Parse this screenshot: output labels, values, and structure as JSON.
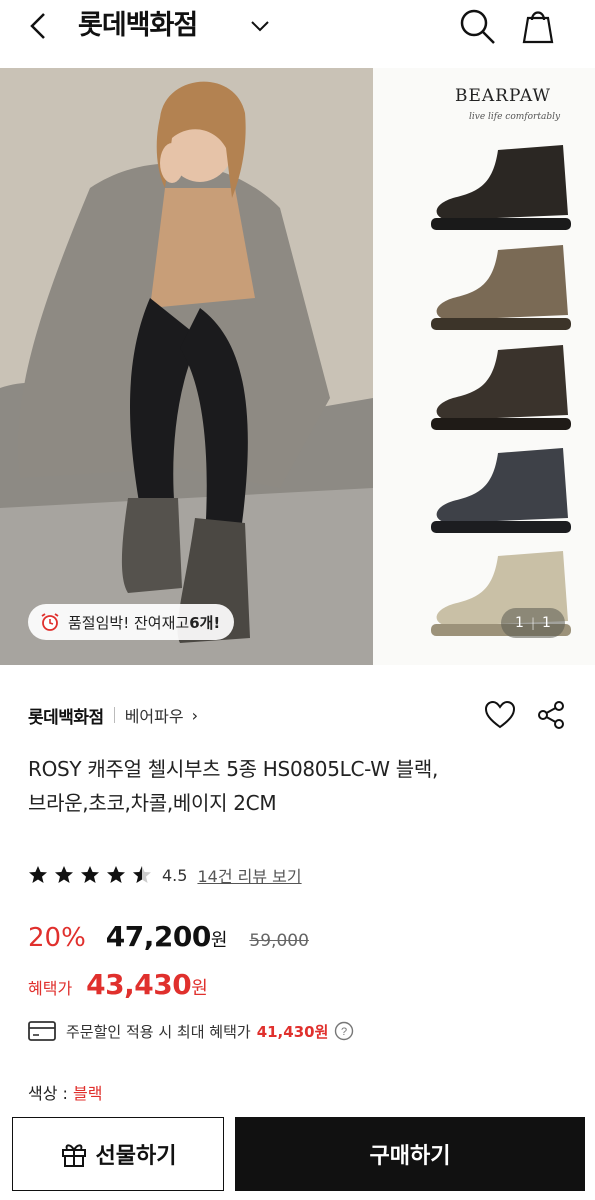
{
  "header": {
    "title": "롯데백화점",
    "icons": [
      "back-icon",
      "chevron-down-icon",
      "search-icon",
      "shopping-bag-icon"
    ]
  },
  "hero": {
    "brand_logo": "BEARPAW",
    "brand_tagline": "live life comfortably",
    "stock_badge": {
      "prefix": "품절임박! 잔여재고 ",
      "count": "6개!"
    },
    "page_indicator": {
      "current": "1",
      "total": "1"
    },
    "boot_colors": [
      "#2b2723",
      "#7a6a55",
      "#3a332c",
      "#3e4148",
      "#c9c0a6"
    ]
  },
  "product": {
    "seller": "롯데백화점",
    "brand": "베어파우",
    "name": "ROSY 캐주얼 첼시부츠 5종 HS0805LC-W 블랙,브라운,초코,차콜,베이지 2CM",
    "rating": "4.5",
    "review_link": "14건 리뷰 보기"
  },
  "price": {
    "discount": "20%",
    "sale_price": "47,200",
    "unit": "원",
    "original_price": "59,000",
    "benefit_label": "혜택가",
    "benefit_price": "43,430",
    "coupon_text": "주문할인 적용 시 최대 혜택가",
    "coupon_amount": "41,430원"
  },
  "option": {
    "label": "색상 : ",
    "value": "블랙"
  },
  "bottom_bar": {
    "gift_label": "선물하기",
    "buy_label": "구매하기"
  },
  "colors": {
    "accent_red": "#e0302d",
    "dark": "#111111"
  }
}
